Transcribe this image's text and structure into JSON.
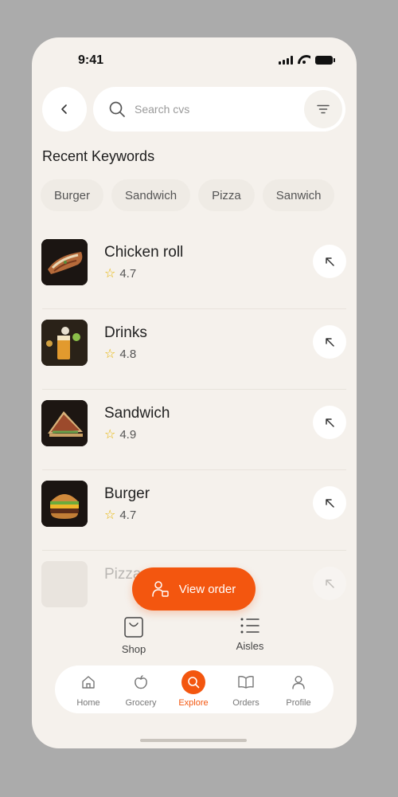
{
  "status_bar": {
    "time": "9:41"
  },
  "search": {
    "placeholder": "Search cvs"
  },
  "recent": {
    "title": "Recent Keywords",
    "chips": [
      "Burger",
      "Sandwich",
      "Pizza",
      "Sanwich"
    ]
  },
  "results": [
    {
      "name": "Chicken roll",
      "rating": "4.7",
      "image": "chicken-roll-photo"
    },
    {
      "name": "Drinks",
      "rating": "4.8",
      "image": "drinks-photo"
    },
    {
      "name": "Sandwich",
      "rating": "4.9",
      "image": "sandwich-photo"
    },
    {
      "name": "Burger",
      "rating": "4.7",
      "image": "burger-photo"
    },
    {
      "name": "Pizza",
      "rating": "",
      "image": "pizza-photo"
    }
  ],
  "view_order": {
    "label": "View order"
  },
  "sub_tabs": {
    "shop": "Shop",
    "aisles": "Aisles"
  },
  "nav": {
    "home": "Home",
    "grocery": "Grocery",
    "explore": "Explore",
    "orders": "Orders",
    "profile": "Profile",
    "active": "Explore"
  },
  "colors": {
    "accent": "#f3560f",
    "background": "#f5f1ec",
    "star": "#e6b400"
  }
}
